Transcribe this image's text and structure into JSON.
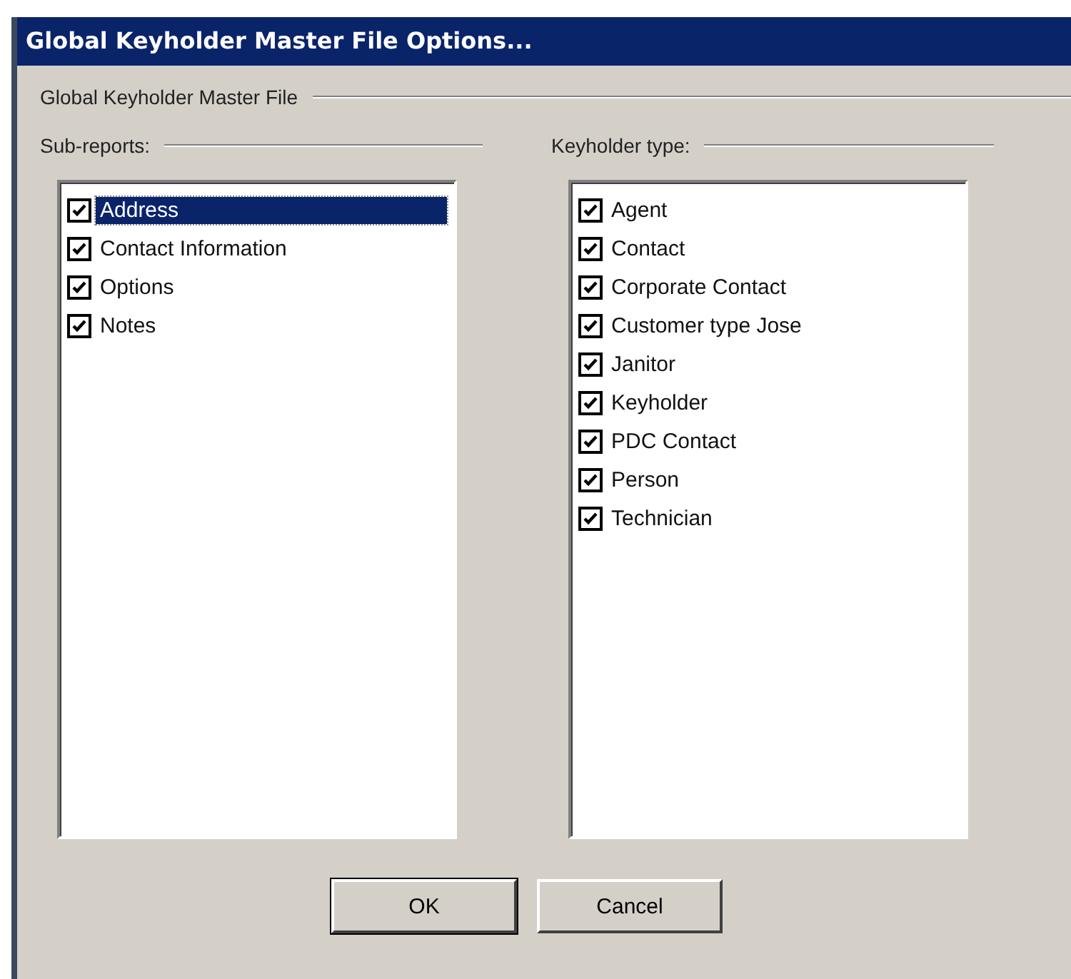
{
  "window": {
    "title": "Global Keyholder Master File Options..."
  },
  "group_label": "Global Keyholder Master File",
  "sub_reports": {
    "label": "Sub-reports:",
    "items": [
      {
        "label": "Address",
        "checked": true,
        "selected": true
      },
      {
        "label": "Contact Information",
        "checked": true,
        "selected": false
      },
      {
        "label": "Options",
        "checked": true,
        "selected": false
      },
      {
        "label": "Notes",
        "checked": true,
        "selected": false
      }
    ]
  },
  "keyholder_type": {
    "label": "Keyholder type:",
    "items": [
      {
        "label": "Agent",
        "checked": true,
        "selected": false
      },
      {
        "label": "Contact",
        "checked": true,
        "selected": false
      },
      {
        "label": "Corporate Contact",
        "checked": true,
        "selected": false
      },
      {
        "label": "Customer type Jose",
        "checked": true,
        "selected": false
      },
      {
        "label": "Janitor",
        "checked": true,
        "selected": false
      },
      {
        "label": "Keyholder",
        "checked": true,
        "selected": false
      },
      {
        "label": "PDC Contact",
        "checked": true,
        "selected": false
      },
      {
        "label": "Person",
        "checked": true,
        "selected": false
      },
      {
        "label": "Technician",
        "checked": true,
        "selected": false
      }
    ]
  },
  "buttons": [
    "OK",
    "Cancel"
  ]
}
